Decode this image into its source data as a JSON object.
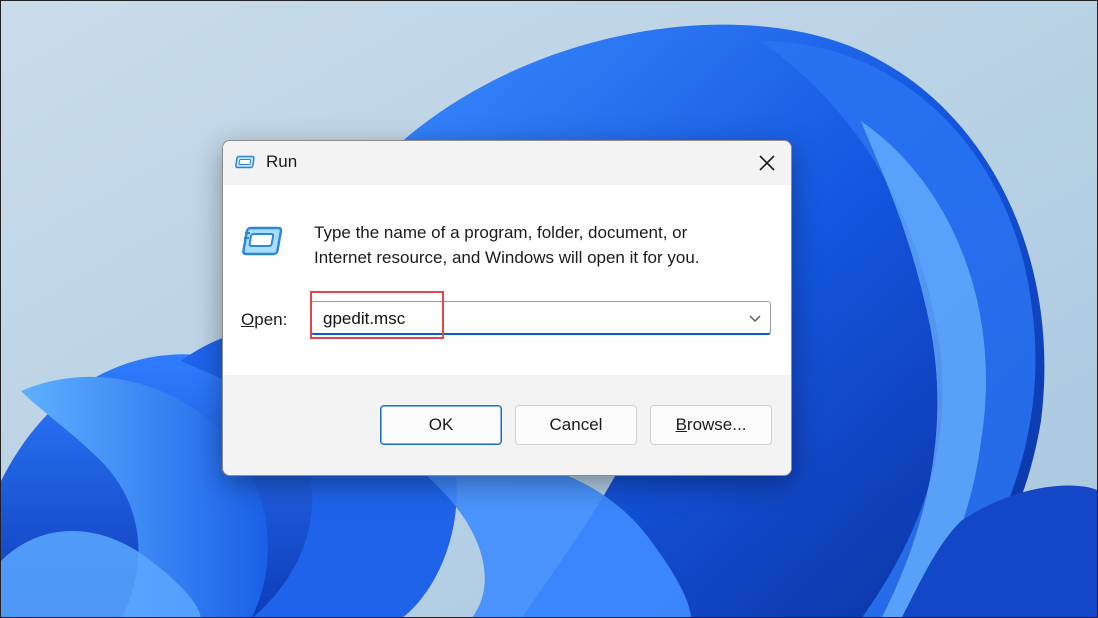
{
  "window": {
    "title": "Run",
    "close_icon": "close-icon",
    "app_icon": "run-icon"
  },
  "body": {
    "description_line1": "Type the name of a program, folder, document, or",
    "description_line2": "Internet resource, and Windows will open it for you.",
    "open_label_first": "O",
    "open_label_rest": "pen:",
    "open_value": "gpedit.msc",
    "chevron_icon": "chevron-down-icon"
  },
  "buttons": {
    "ok": "OK",
    "cancel": "Cancel",
    "browse_first": "B",
    "browse_rest": "rowse..."
  },
  "colors": {
    "accent": "#0b5cc8",
    "highlight": "#e0474c",
    "wallpaper_bg": "#b9d2e6",
    "bloom_blue": "#1a5fe0"
  }
}
